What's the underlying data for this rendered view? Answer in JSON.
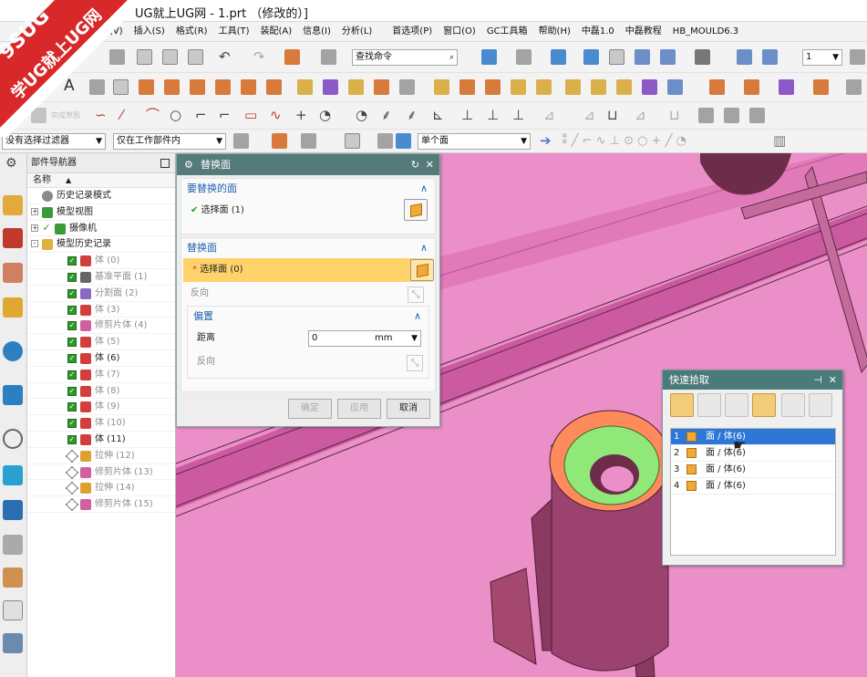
{
  "app": {
    "title": "UG就上UG网 - 1.prt （修改的）]"
  },
  "menu": [
    "(V)",
    "插入(S)",
    "格式(R)",
    "工具(T)",
    "装配(A)",
    "信息(I)",
    "分析(L)",
    "首选项(P)",
    "窗口(O)",
    "GC工具箱",
    "帮助(H)",
    "中磊1.0",
    "中磊教程",
    "HB_MOULD6.3"
  ],
  "toolbar": {
    "search_placeholder": "查找命令",
    "layer_value": "1",
    "ghost_label": "完成草图"
  },
  "filterbar": {
    "type_filter": "没有选择过滤器",
    "scope_filter": "仅在工作部件内",
    "face_rule": "单个面"
  },
  "navigator": {
    "title": "部件导航器",
    "col_name": "名称",
    "sort": "▲",
    "items": [
      {
        "label": "历史记录模式",
        "kind": "clock",
        "indent": 1,
        "check": "none",
        "style": "dark"
      },
      {
        "label": "模型视图",
        "kind": "view",
        "indent": 1,
        "check": "none",
        "style": "dark",
        "expand": "+"
      },
      {
        "label": "摄像机",
        "kind": "camera",
        "indent": 1,
        "check": "green",
        "style": "dark",
        "expand": "+"
      },
      {
        "label": "模型历史记录",
        "kind": "folder",
        "indent": 1,
        "check": "none",
        "style": "dark",
        "expand": "-"
      },
      {
        "label": "体 (0)",
        "kind": "body",
        "indent": 2,
        "check": "checked",
        "style": "gray"
      },
      {
        "label": "基准平面 (1)",
        "kind": "plane",
        "indent": 2,
        "check": "checked",
        "style": "gray"
      },
      {
        "label": "分割面 (2)",
        "kind": "split",
        "indent": 2,
        "check": "checked",
        "style": "gray"
      },
      {
        "label": "体 (3)",
        "kind": "body",
        "indent": 2,
        "check": "checked",
        "style": "gray"
      },
      {
        "label": "修剪片体 (4)",
        "kind": "trim",
        "indent": 2,
        "check": "checked",
        "style": "gray"
      },
      {
        "label": "体 (5)",
        "kind": "body",
        "indent": 2,
        "check": "checked",
        "style": "gray"
      },
      {
        "label": "体 (6)",
        "kind": "body",
        "indent": 2,
        "check": "checked",
        "style": "dark"
      },
      {
        "label": "体 (7)",
        "kind": "body",
        "indent": 2,
        "check": "checked",
        "style": "gray"
      },
      {
        "label": "体 (8)",
        "kind": "body",
        "indent": 2,
        "check": "checked",
        "style": "gray"
      },
      {
        "label": "体 (9)",
        "kind": "body",
        "indent": 2,
        "check": "checked",
        "style": "gray"
      },
      {
        "label": "体 (10)",
        "kind": "body",
        "indent": 2,
        "check": "checked",
        "style": "gray"
      },
      {
        "label": "体 (11)",
        "kind": "body",
        "indent": 2,
        "check": "checked",
        "style": "dark"
      },
      {
        "label": "拉伸 (12)",
        "kind": "extrude",
        "indent": 2,
        "check": "unchecked",
        "style": "gray"
      },
      {
        "label": "修剪片体 (13)",
        "kind": "trim",
        "indent": 2,
        "check": "unchecked",
        "style": "gray"
      },
      {
        "label": "拉伸 (14)",
        "kind": "extrude",
        "indent": 2,
        "check": "unchecked",
        "style": "gray"
      },
      {
        "label": "修剪片体 (15)",
        "kind": "trim",
        "indent": 2,
        "check": "unchecked",
        "style": "gray"
      }
    ]
  },
  "dialog": {
    "title": "替换面",
    "sec1": {
      "title": "要替换的面",
      "select_label": "选择面 (1)"
    },
    "sec2": {
      "title": "替换面",
      "select_label": "选择面 (0)",
      "reverse_label": "反向"
    },
    "offset": {
      "title": "偏置",
      "distance_label": "距离",
      "distance_value": "0",
      "unit": "mm",
      "reverse_label": "反向"
    },
    "buttons": {
      "ok": "确定",
      "apply": "应用",
      "cancel": "取消"
    }
  },
  "quickpick": {
    "title": "快速拾取",
    "rows": [
      {
        "n": "1",
        "label": "面 / 体(6)"
      },
      {
        "n": "2",
        "label": "面 / 体(6)"
      },
      {
        "n": "3",
        "label": "面 / 体(6)"
      },
      {
        "n": "4",
        "label": "面 / 体(6)"
      }
    ]
  },
  "watermark": {
    "line1": "9SUG",
    "line2": "学UG就上UG网"
  },
  "colors": {
    "accent": "#557a7a",
    "viewport": "#eb8fc8",
    "highlight": "#2d78d6",
    "face_green": "#8fe878",
    "face_orange": "#ff8a5c"
  }
}
